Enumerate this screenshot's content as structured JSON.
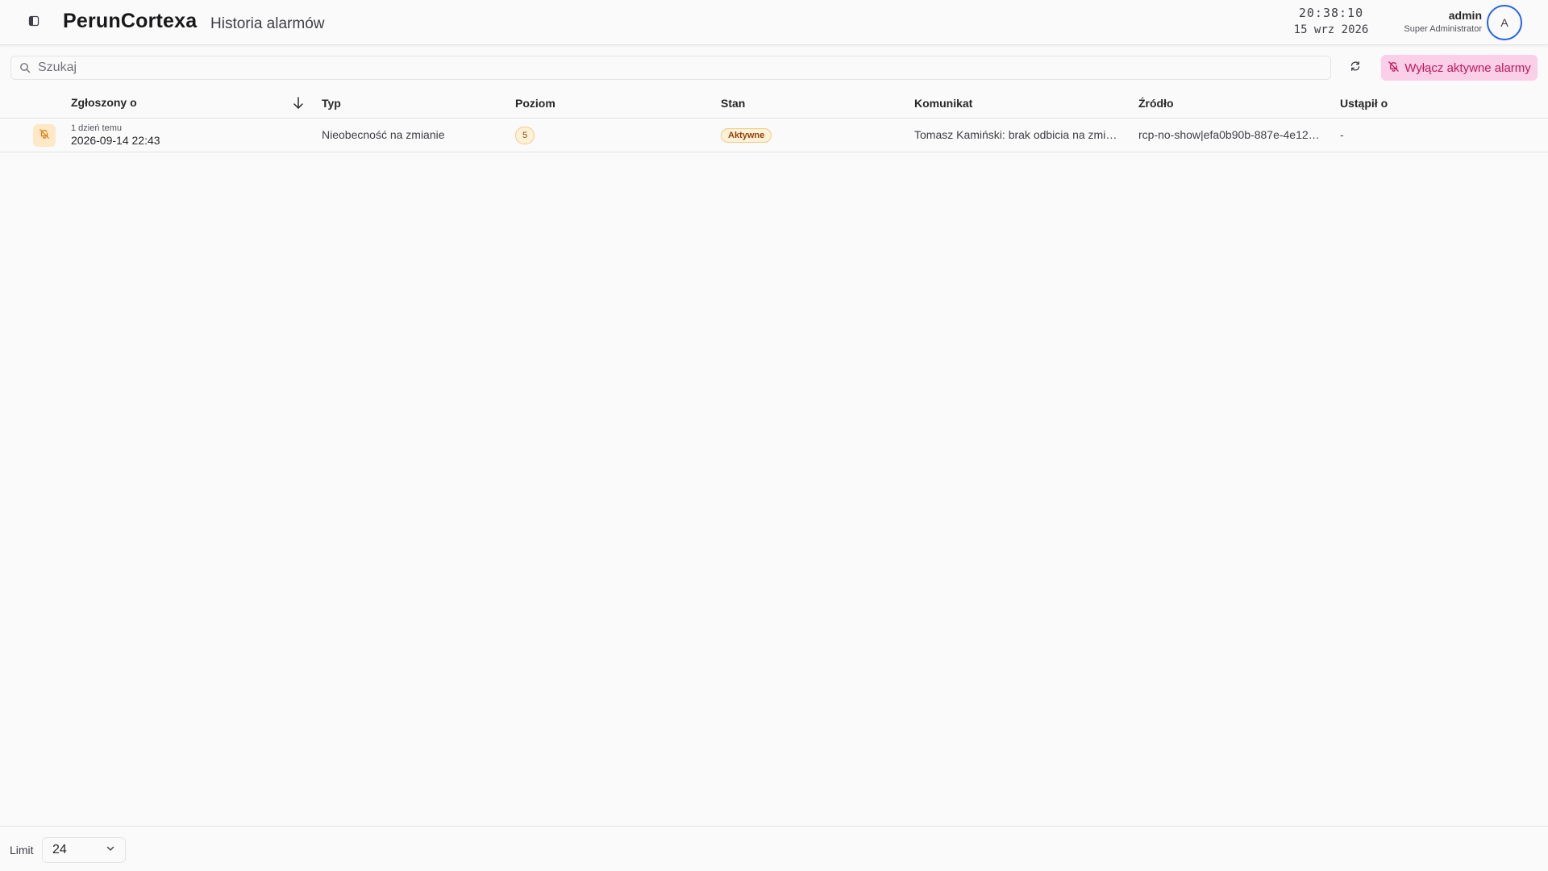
{
  "header": {
    "brand": "PerunCortexa",
    "page_title": "Historia alarmów",
    "clock_time": "20:38:10",
    "clock_date": "15 wrz 2026",
    "user_name": "admin",
    "user_role": "Super Administrator",
    "avatar_initial": "A",
    "icons": {
      "sidebar_toggle": "sidebar-toggle-icon"
    }
  },
  "toolbar": {
    "search_placeholder": "Szukaj",
    "search_value": "",
    "refresh_icon": "refresh-icon",
    "disable_alarms_label": "Wyłącz aktywne alarmy",
    "disable_alarms_icon": "bell-off-icon"
  },
  "table": {
    "columns": {
      "reported_at": "Zgłoszony o",
      "type": "Typ",
      "level": "Poziom",
      "state": "Stan",
      "message": "Komunikat",
      "source": "Źródło",
      "yielded_at": "Ustąpił o"
    },
    "sort": {
      "column": "reported_at",
      "direction": "desc"
    },
    "rows": [
      {
        "icon": "bell-off-icon",
        "relative": "1 dzień temu",
        "reported_at": "2026-09-14 22:43",
        "type": "Nieobecność na zmianie",
        "level": "5",
        "state": "Aktywne",
        "message": "Tomasz Kamiński: brak odbicia na zmia…",
        "source": "rcp-no-show|efa0b90b-887e-4e12…",
        "yielded_at": "-"
      }
    ]
  },
  "footer": {
    "limit_label": "Limit",
    "limit_value": "24"
  },
  "colors": {
    "accent_pink_bg": "#fbcfe8",
    "accent_pink_text": "#be185d",
    "badge_bg": "#fdf1d6",
    "avatar_ring": "#2563eb"
  }
}
